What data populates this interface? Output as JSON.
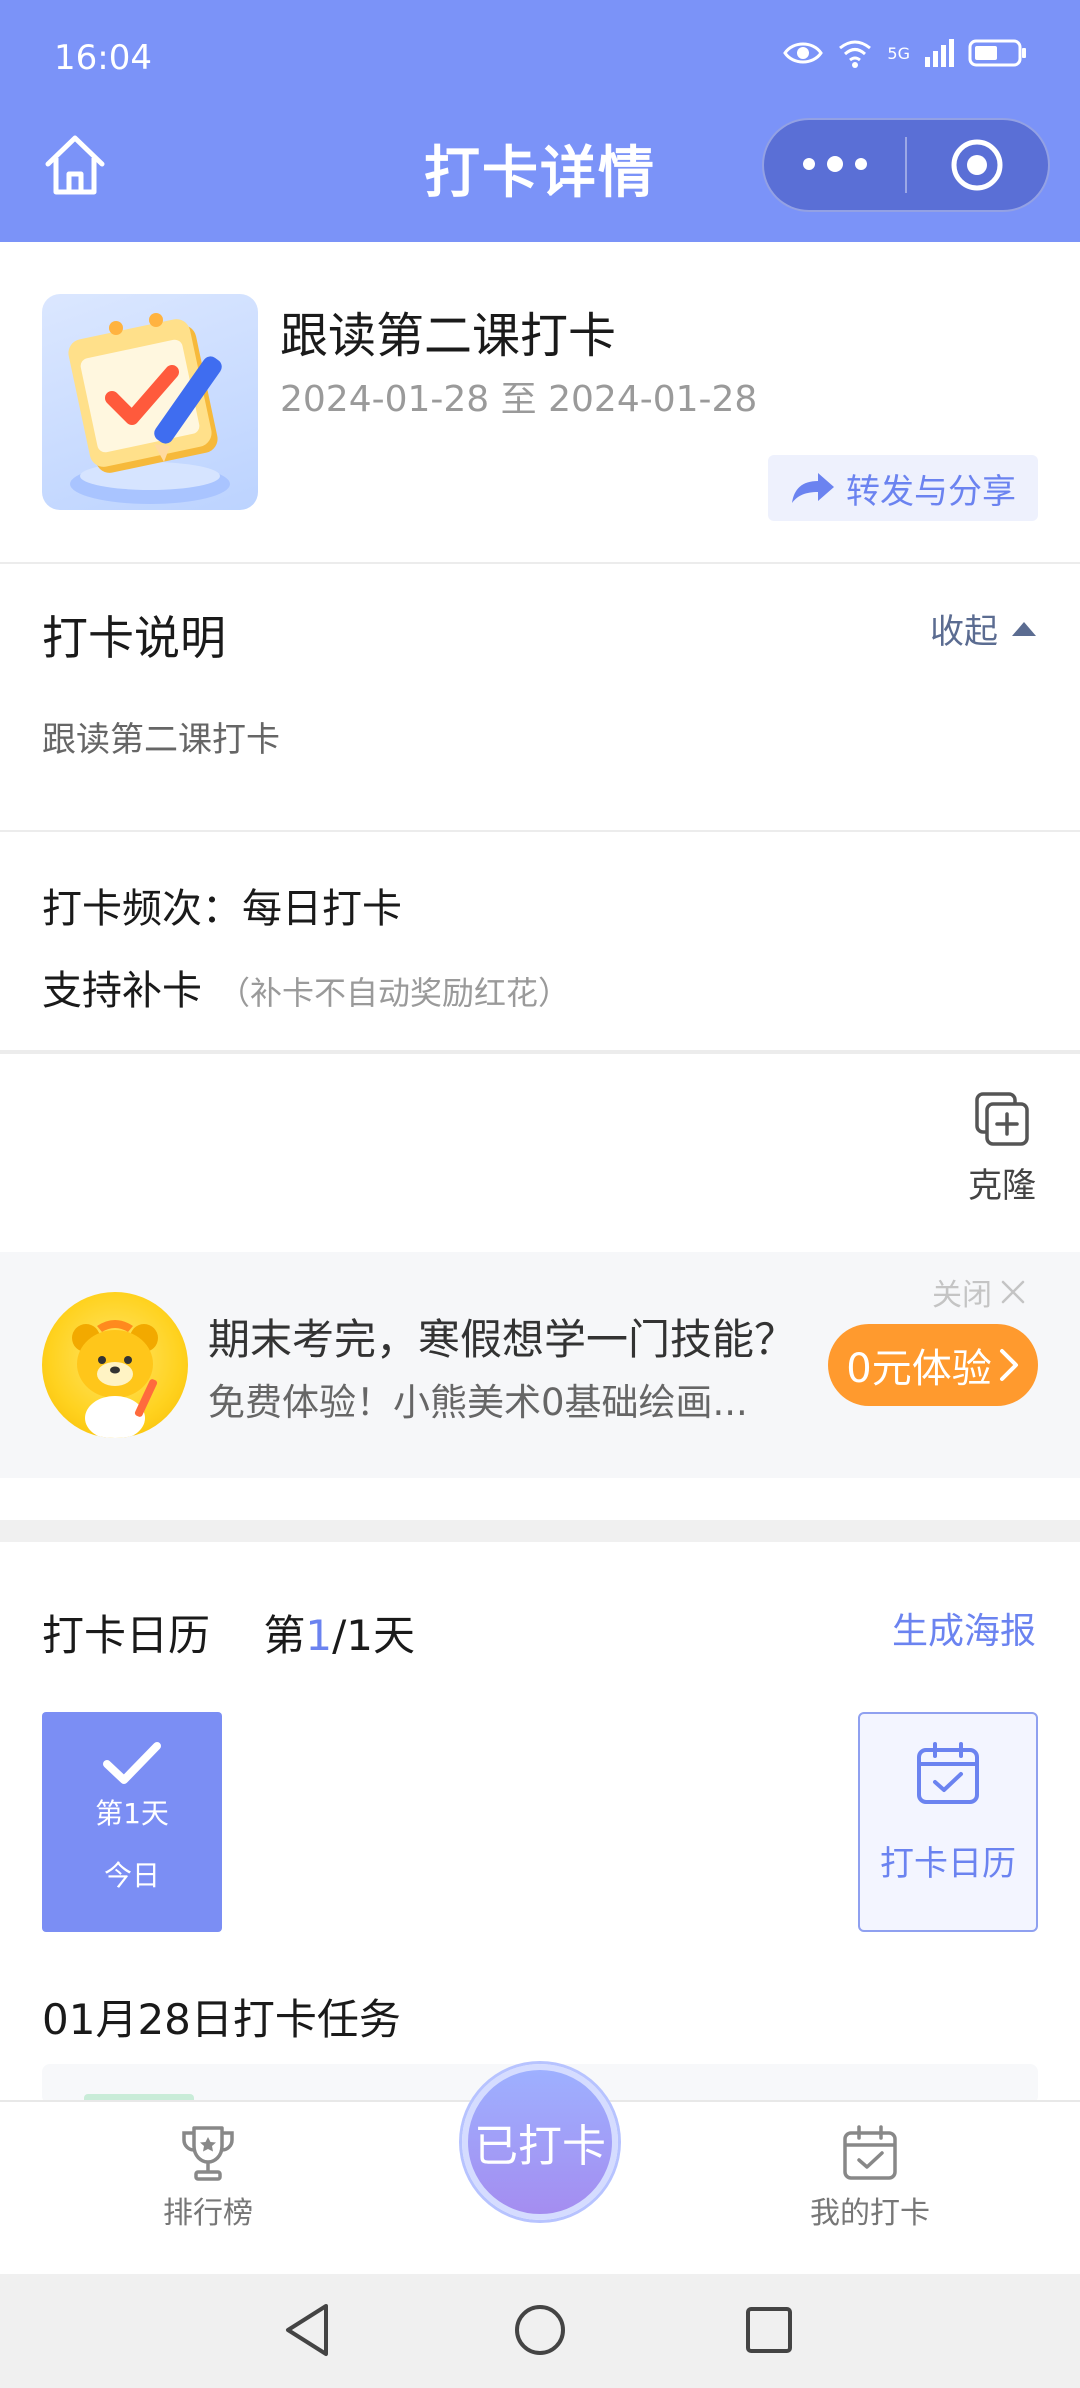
{
  "status_bar": {
    "time": "16:04",
    "network": "5G"
  },
  "nav": {
    "title": "打卡详情"
  },
  "task": {
    "title": "跟读第二课打卡",
    "date_range": "2024-01-28 至 2024-01-28",
    "share_label": "转发与分享"
  },
  "description": {
    "heading": "打卡说明",
    "collapse_label": "收起",
    "text": "跟读第二课打卡"
  },
  "rules": {
    "frequency": "打卡频次：每日打卡",
    "makeup": "支持补卡",
    "makeup_note": "（补卡不自动奖励红花）"
  },
  "clone_label": "克隆",
  "ad": {
    "close_label": "关闭",
    "title": "期末考完，寒假想学一门技能？",
    "subtitle": "免费体验！小熊美术0基础绘画...",
    "button_label": "0元体验"
  },
  "calendar": {
    "heading": "打卡日历",
    "progress_prefix": "第",
    "progress_current": "1",
    "progress_suffix": "/1天",
    "poster_label": "生成海报",
    "day_label": "第1天",
    "day_sub": "今日",
    "calendar_button_label": "打卡日历"
  },
  "task_of_day": "01月28日打卡任务",
  "tabbar": {
    "left_label": "排行榜",
    "center_label": "已打卡",
    "right_label": "我的打卡"
  },
  "colors": {
    "primary": "#7b93f8",
    "accent_orange": "#ff9a2e",
    "link_blue": "#6b83f0"
  }
}
